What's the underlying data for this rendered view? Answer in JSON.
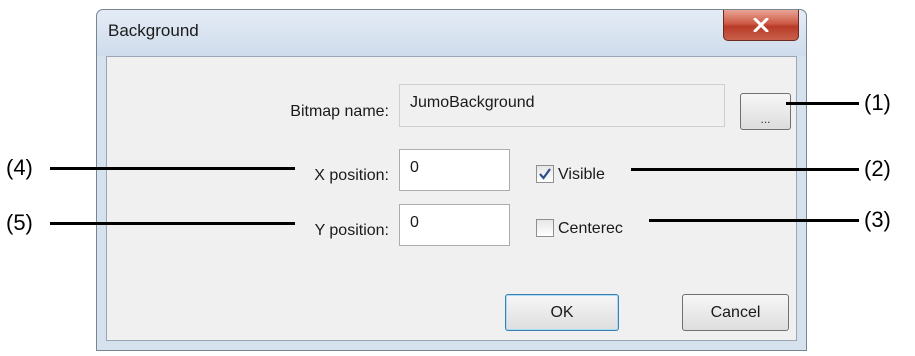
{
  "dialog": {
    "title": "Background",
    "close_icon": "close-x-icon",
    "bitmap": {
      "label": "Bitmap name:",
      "value": "JumoBackground",
      "browse_label": "..."
    },
    "x_position": {
      "label": "X position:",
      "value": "0"
    },
    "y_position": {
      "label": "Y position:",
      "value": "0"
    },
    "visible": {
      "label": "Visible",
      "checked": true
    },
    "centered": {
      "label": "Centerec",
      "checked": false
    },
    "ok_label": "OK",
    "cancel_label": "Cancel"
  },
  "callouts": [
    "(1)",
    "(2)",
    "(3)",
    "(4)",
    "(5)"
  ],
  "colors": {
    "close_button": "#c8473a",
    "default_button_border": "#3c7fb1",
    "checkmark": "#2d4f8a"
  }
}
